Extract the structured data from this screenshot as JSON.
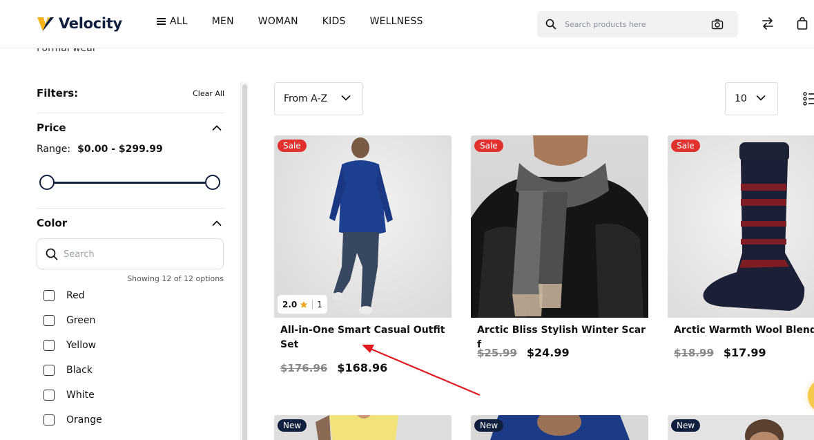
{
  "brand": {
    "name": "Velocity",
    "colors": {
      "navy": "#0f1f3d",
      "accent": "#f5b316",
      "sale": "#e0312e"
    }
  },
  "nav": {
    "all_label": "ALL",
    "men_label": "MEN",
    "woman_label": "WOMAN",
    "kids_label": "KIDS",
    "wellness_label": "WELLNESS"
  },
  "search": {
    "placeholder": "Search products here"
  },
  "header_icons": [
    "search-icon",
    "camera-icon",
    "compare-arrows-icon",
    "shopping-bag-icon"
  ],
  "breadcrumb": {
    "current": "Formal wear"
  },
  "filters": {
    "title": "Filters:",
    "clear_all": "Clear All",
    "price": {
      "title": "Price",
      "range_label": "Range:",
      "range_value": "$0.00 - $299.99",
      "min": 0.0,
      "max": 299.99
    },
    "color": {
      "title": "Color",
      "search_placeholder": "Search",
      "showing": "Showing 12 of 12 options",
      "options": [
        {
          "label": "Red",
          "checked": false
        },
        {
          "label": "Green",
          "checked": false
        },
        {
          "label": "Yellow",
          "checked": false
        },
        {
          "label": "Black",
          "checked": false
        },
        {
          "label": "White",
          "checked": false
        },
        {
          "label": "Orange",
          "checked": false
        }
      ]
    }
  },
  "toolbar": {
    "sort_value": "From A-Z",
    "per_page_value": "10"
  },
  "products": [
    {
      "badge": "Sale",
      "rating": "2.0",
      "reviews": "1",
      "name": "All-in-One Smart Casual Outfit Set",
      "old_price": "$176.96",
      "price": "$168.96"
    },
    {
      "badge": "Sale",
      "name": "Arctic Bliss Stylish Winter Scarf",
      "old_price": "$25.99",
      "price": "$24.99"
    },
    {
      "badge": "Sale",
      "name": "Arctic Warmth Wool Blend S",
      "old_price": "$18.99",
      "price": "$17.99"
    },
    {
      "badge": "New"
    },
    {
      "badge": "New"
    },
    {
      "badge": "New"
    }
  ]
}
